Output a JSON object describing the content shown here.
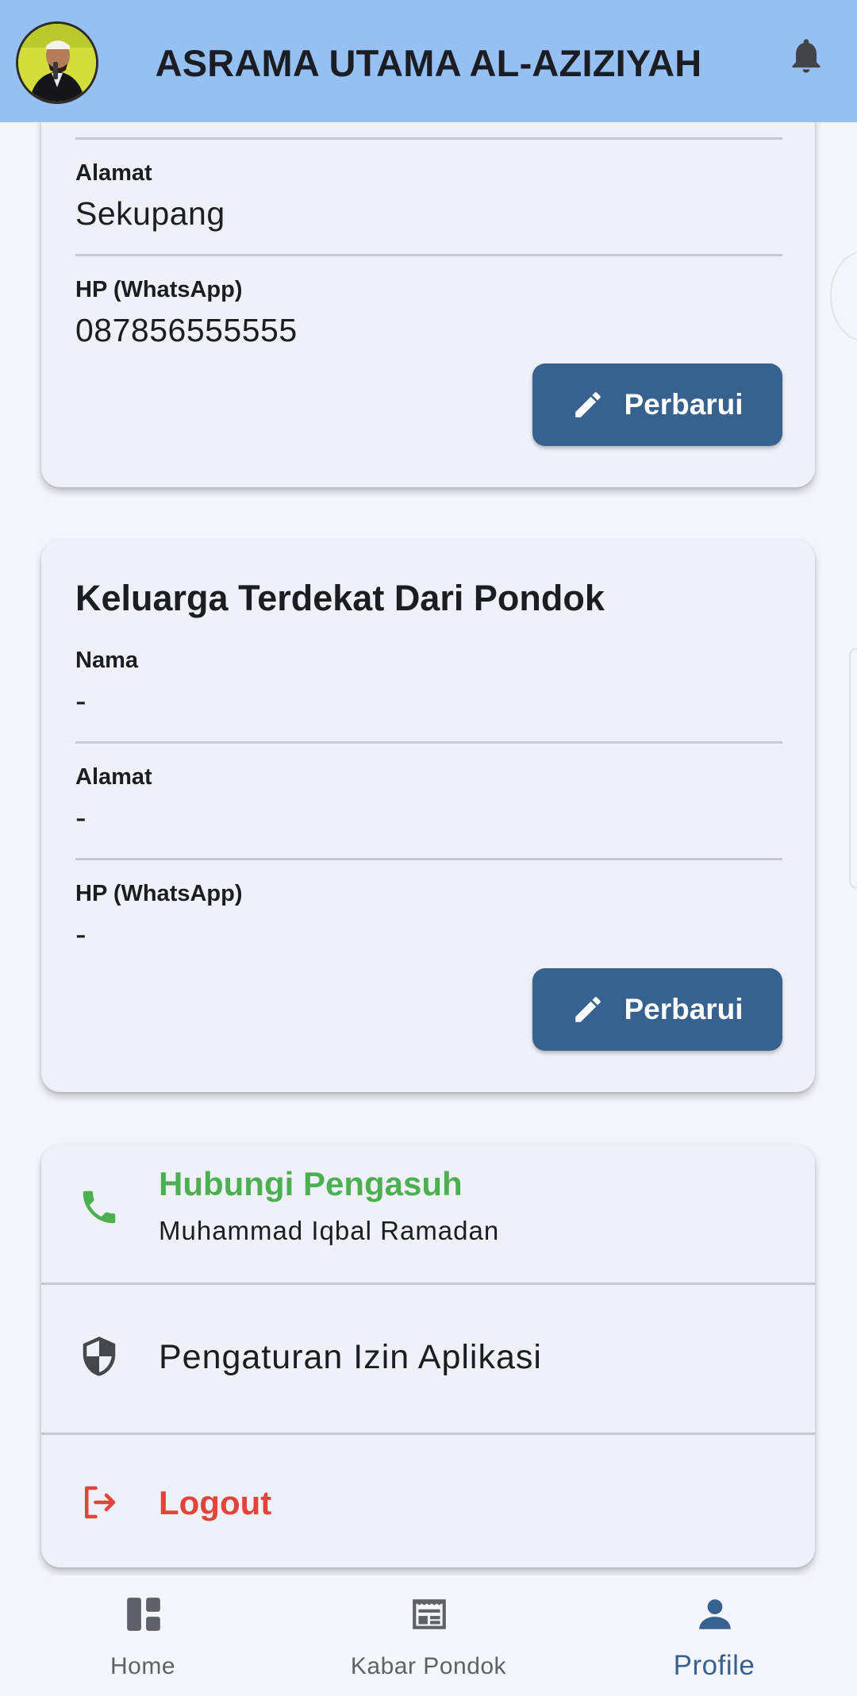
{
  "appbar": {
    "title": "ASRAMA UTAMA AL-AZIZIYAH"
  },
  "card1": {
    "fields": [
      {
        "label": "Alamat",
        "value": "Sekupang"
      },
      {
        "label": "HP (WhatsApp)",
        "value": "087856555555"
      }
    ],
    "update_label": "Perbarui"
  },
  "card2": {
    "title": "Keluarga Terdekat Dari Pondok",
    "fields": [
      {
        "label": "Nama",
        "value": "-"
      },
      {
        "label": "Alamat",
        "value": "-"
      },
      {
        "label": "HP (WhatsApp)",
        "value": "-"
      }
    ],
    "update_label": "Perbarui"
  },
  "menu": {
    "contact_title": "Hubungi Pengasuh",
    "contact_name": "Muhammad Iqbal Ramadan",
    "permissions_label": "Pengaturan Izin Aplikasi",
    "logout_label": "Logout"
  },
  "bottom_nav": {
    "items": [
      {
        "label": "Home",
        "icon": "dashboard-icon"
      },
      {
        "label": "Kabar Pondok",
        "icon": "newspaper-icon"
      },
      {
        "label": "Profile",
        "icon": "person-icon",
        "active": true
      }
    ]
  },
  "colors": {
    "appbar": "#96c0f2",
    "primary": "#37618f",
    "contact_green": "#4caf50",
    "logout_red": "#e0443a"
  }
}
